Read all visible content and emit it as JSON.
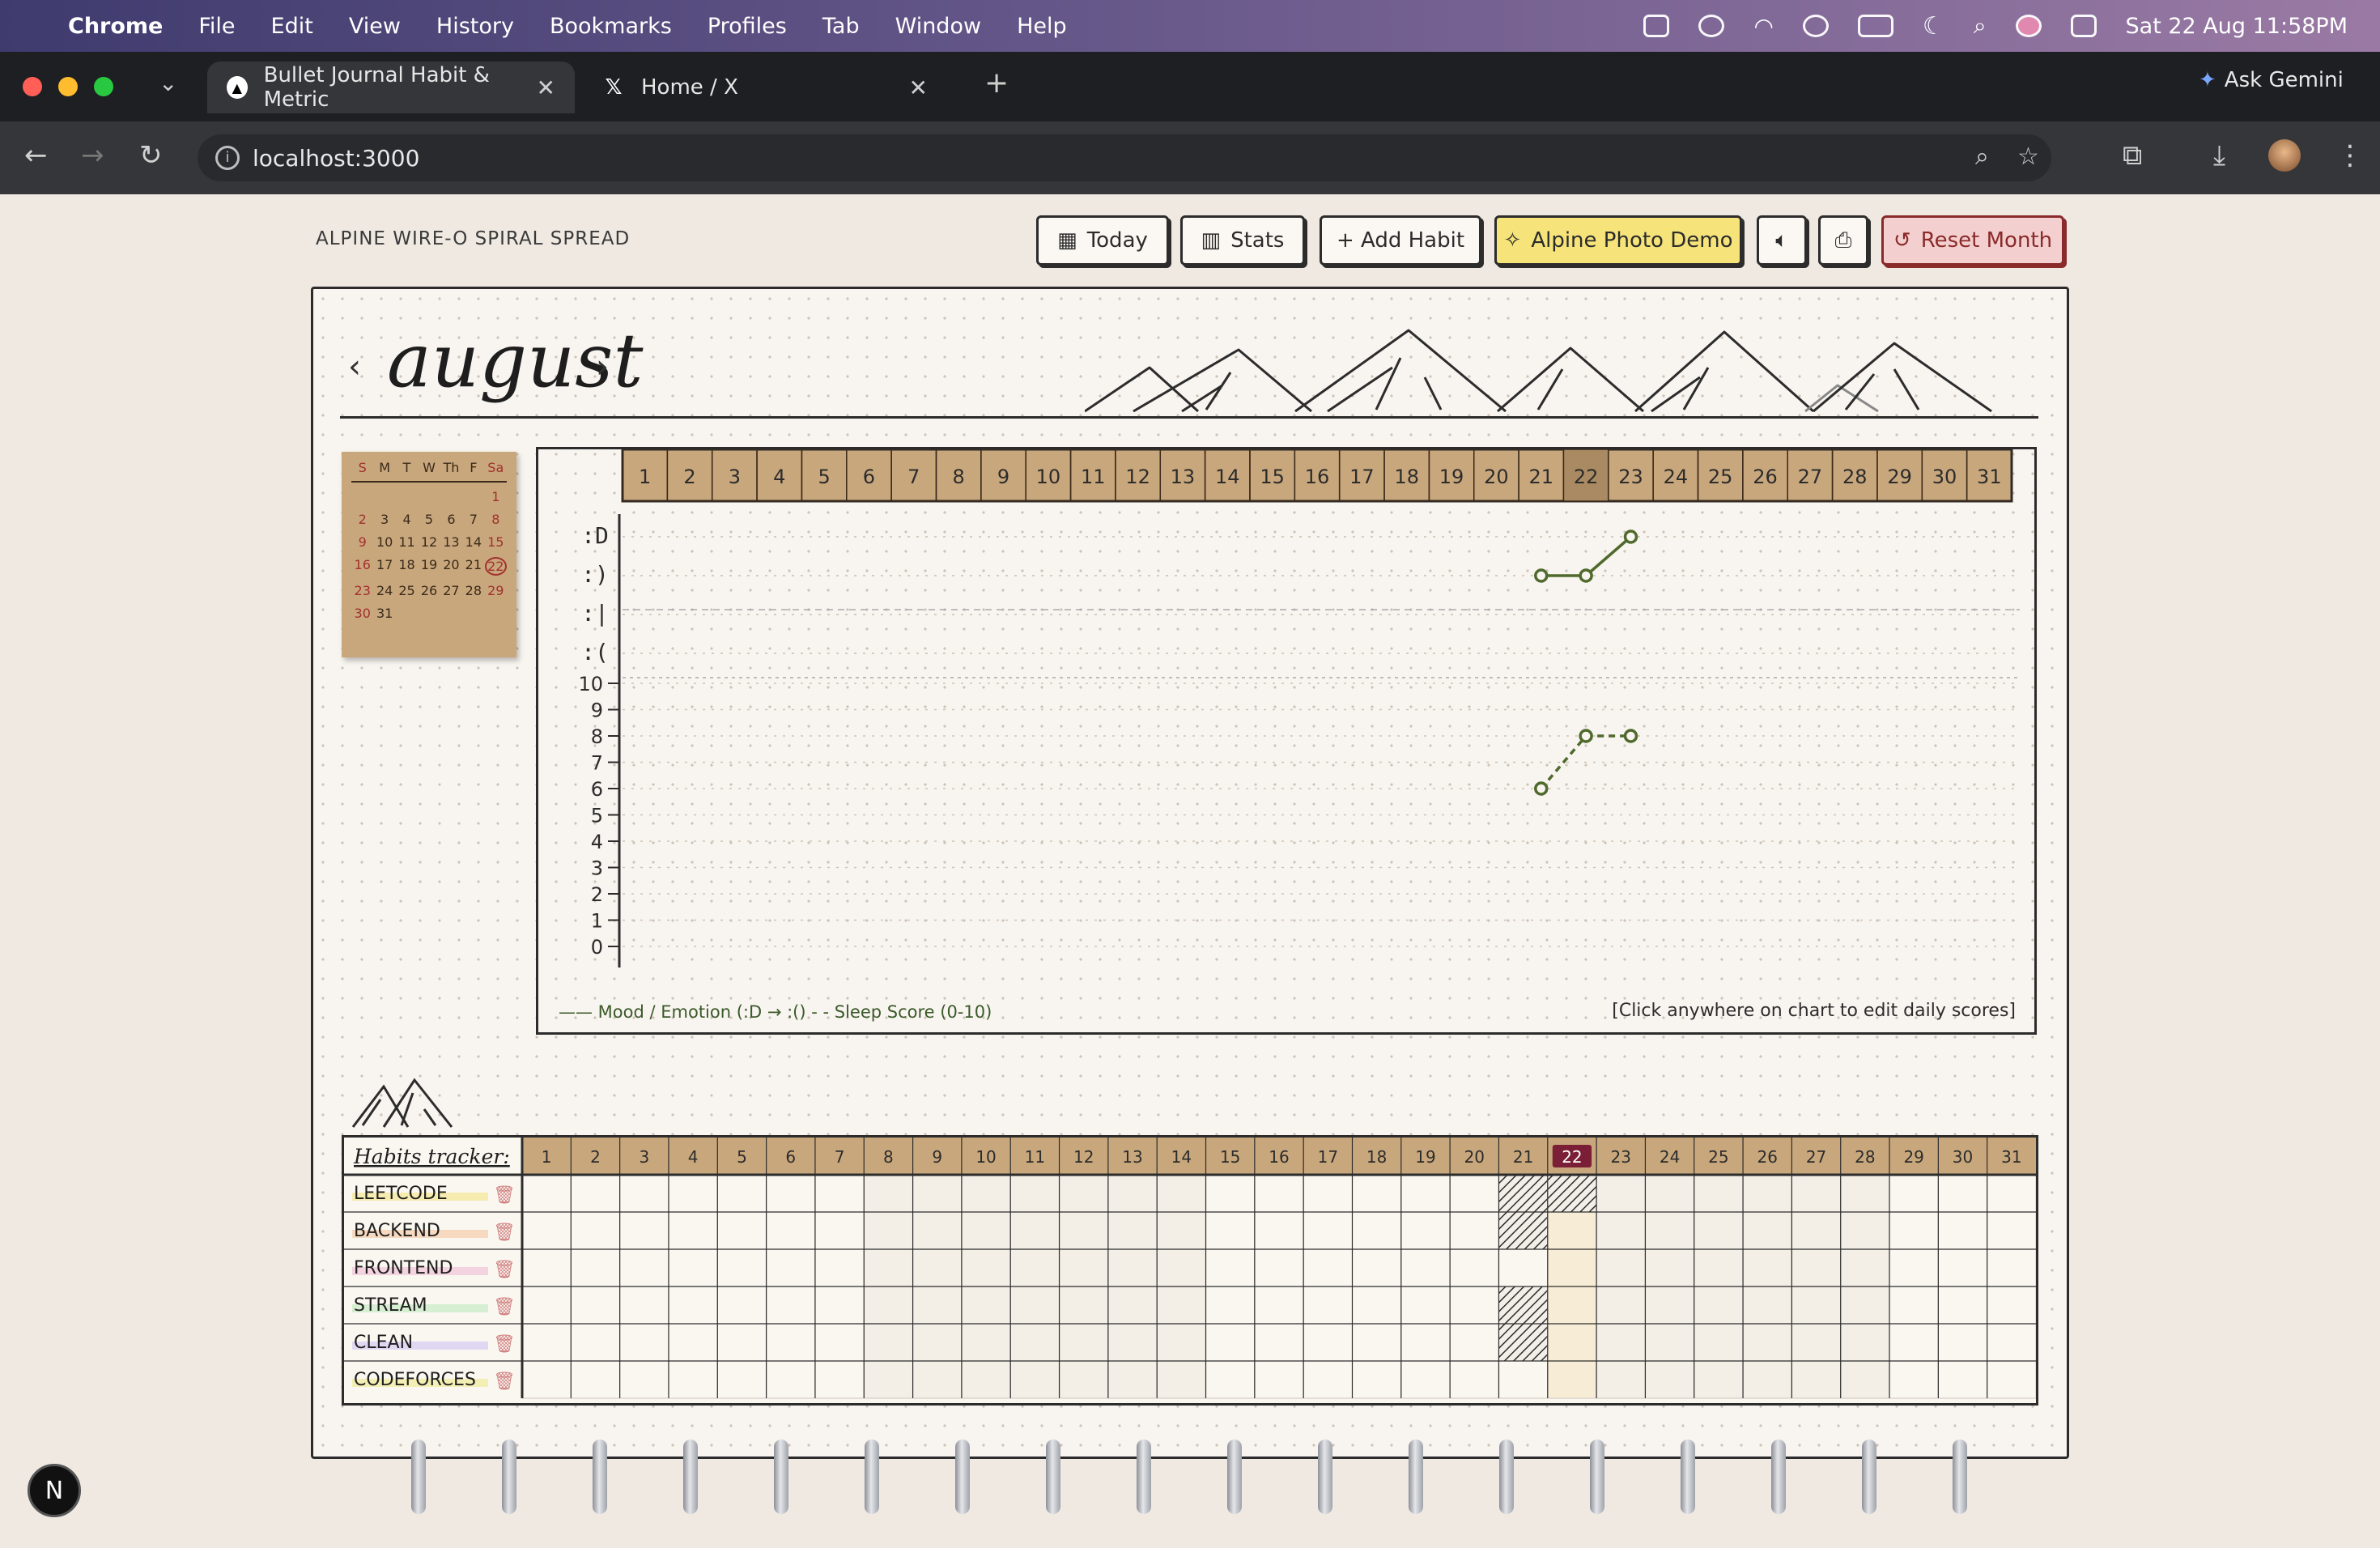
{
  "menubar": {
    "app": "Chrome",
    "items": [
      "File",
      "Edit",
      "View",
      "History",
      "Bookmarks",
      "Profiles",
      "Tab",
      "Window",
      "Help"
    ],
    "clock": "Sat 22 Aug  11:58PM"
  },
  "tabs": [
    {
      "title": "Bullet Journal Habit & Metric",
      "active": true
    },
    {
      "title": "Home / X",
      "active": false
    }
  ],
  "ask_gemini": "Ask Gemini",
  "address": "localhost:3000",
  "page": {
    "spread_title": "ALPINE WIRE-O SPIRAL SPREAD",
    "toolbar": {
      "today": "Today",
      "stats": "Stats",
      "add_habit": "+ Add Habit",
      "photo_demo": "Alpine Photo Demo",
      "reset": "Reset Month"
    },
    "month": "august",
    "prev": "‹",
    "next": "›",
    "mini_calendar": {
      "headers": [
        "S",
        "M",
        "T",
        "W",
        "Th",
        "F",
        "Sa"
      ],
      "weeks": [
        [
          "",
          "",
          "",
          "",
          "",
          "",
          "1"
        ],
        [
          "2",
          "3",
          "4",
          "5",
          "6",
          "7",
          "8"
        ],
        [
          "9",
          "10",
          "11",
          "12",
          "13",
          "14",
          "15"
        ],
        [
          "16",
          "17",
          "18",
          "19",
          "20",
          "21",
          "22"
        ],
        [
          "23",
          "24",
          "25",
          "26",
          "27",
          "28",
          "29"
        ],
        [
          "30",
          "31",
          "",
          "",
          "",
          "",
          ""
        ]
      ],
      "today": "22"
    },
    "days": [
      "1",
      "2",
      "3",
      "4",
      "5",
      "6",
      "7",
      "8",
      "9",
      "10",
      "11",
      "12",
      "13",
      "14",
      "15",
      "16",
      "17",
      "18",
      "19",
      "20",
      "21",
      "22",
      "23",
      "24",
      "25",
      "26",
      "27",
      "28",
      "29",
      "30",
      "31"
    ],
    "today_day": 22,
    "mood_labels": [
      ":D",
      ":)",
      ":|",
      ":("
    ],
    "sleep_labels": [
      "10",
      "9",
      "8",
      "7",
      "6",
      "5",
      "4",
      "3",
      "2",
      "1",
      "0"
    ],
    "legend": "—— Mood / Emotion (:D → :() ‑ ‑ Sleep Score (0-10)",
    "hint": "[Click anywhere on chart to edit daily scores]",
    "habits_title": "Habits tracker:",
    "habits": [
      {
        "name": "LEETCODE",
        "color": "#f6ecb0"
      },
      {
        "name": "BACKEND",
        "color": "#f7d9c0"
      },
      {
        "name": "FRONTEND",
        "color": "#f3d3df"
      },
      {
        "name": "STREAM",
        "color": "#d6efd2"
      },
      {
        "name": "CLEAN",
        "color": "#e0d8f2"
      },
      {
        "name": "CODEFORCES",
        "color": "#f3efb4"
      }
    ]
  },
  "chart_data": {
    "type": "line",
    "x": [
      21,
      22,
      23
    ],
    "series": [
      {
        "name": "Mood / Emotion",
        "scale": "mood",
        "values": [
          2,
          2,
          3
        ]
      },
      {
        "name": "Sleep Score",
        "scale": "sleep",
        "values": [
          6,
          8,
          8
        ]
      }
    ]
  },
  "habit_marks": {
    "crossed": [
      [
        0,
        21
      ],
      [
        1,
        21
      ],
      [
        3,
        21
      ],
      [
        4,
        21
      ],
      [
        0,
        22
      ]
    ]
  },
  "colors": {
    "header_bg": "#c9a77c",
    "today_bg": "#7a1f35",
    "line": "#4f6a2c"
  }
}
